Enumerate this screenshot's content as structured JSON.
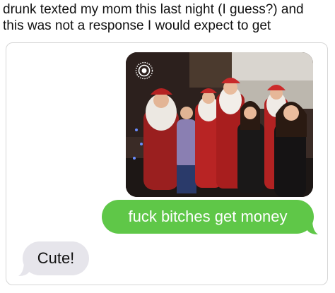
{
  "post": {
    "caption_line1": "drunk texted my mom this last night (I guess?) and",
    "caption_line2": "this was not a response I would expect to get"
  },
  "conversation": {
    "photo_message": {
      "icon": "live-photo-icon",
      "subject": "group photo of people posing with several Santa Claus characters"
    },
    "sent_message": "fuck bitches get money",
    "received_message": "Cute!"
  },
  "colors": {
    "sent_bubble": "#5fc748",
    "received_bubble": "#e6e5eb",
    "card_border": "#d6d6d6"
  }
}
